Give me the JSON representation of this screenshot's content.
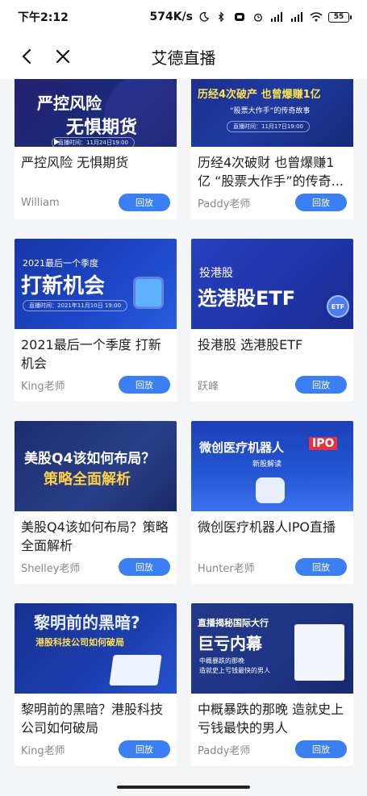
{
  "status_bar": {
    "time": "下午2:12",
    "speed": "574K/s",
    "battery": "55"
  },
  "nav": {
    "title": "艾德直播",
    "back_icon": "chevron-left-icon",
    "close_icon": "close-icon"
  },
  "cards": [
    {
      "title": "严控风险 无惧期货",
      "author": "William",
      "button": "回放",
      "thumb": {
        "line1": "严控风险",
        "line2": "无惧期货",
        "pill": "直播时间：11月24日19:00"
      }
    },
    {
      "title": "历经4次破财 也曾爆赚1亿 “股票大作手”的传奇...",
      "author": "Paddy老师",
      "button": "回放",
      "thumb": {
        "line1": "历经4次破产  也曾爆赚1亿",
        "line2": "“股票大作手”的传奇故事",
        "pill": "直播时间：11月17日19:00"
      }
    },
    {
      "title": "2021最后一个季度 打新机会",
      "author": "King老师",
      "button": "回放",
      "thumb": {
        "line0": "2021最后一个季度",
        "line1": "打新机会",
        "pill": "直播时间：2021年11月10日 19:00"
      }
    },
    {
      "title": "投港股 选港股ETF",
      "author": "跃峰",
      "button": "回放",
      "thumb": {
        "line0": "投港股",
        "line1": "选港股ETF",
        "badge": "ETF"
      }
    },
    {
      "title": "美股Q4该如何布局？策略全面解析",
      "author": "Shelley老师",
      "button": "回放",
      "thumb": {
        "line1": "美股Q4该如何布局？",
        "line2": "策略全面解析"
      }
    },
    {
      "title": "微创医疗机器人IPO直播",
      "author": "Hunter老师",
      "button": "回放",
      "thumb": {
        "line1": "微创医疗机器人",
        "badge": "IPO",
        "line2": "新股解读"
      }
    },
    {
      "title": "黎明前的黑暗？港股科技公司如何破局",
      "author": "King老师",
      "button": "回放",
      "thumb": {
        "line1": "黎明前的黑暗?",
        "line2": "港股科技公司如何破局"
      }
    },
    {
      "title": "中概暴跌的那晚 造就史上亏钱最快的男人",
      "author": "Paddy老师",
      "button": "回放",
      "thumb": {
        "line0": "直播揭秘国际大行",
        "line1": "巨亏内幕",
        "line2": "中概暴跌的那晚",
        "line3": "造就史上亏钱最快的男人"
      }
    }
  ],
  "colors": {
    "accent": "#3a7ff4",
    "page_bg": "#f4f5f7",
    "thumb_dark": "#1b2a7a"
  }
}
